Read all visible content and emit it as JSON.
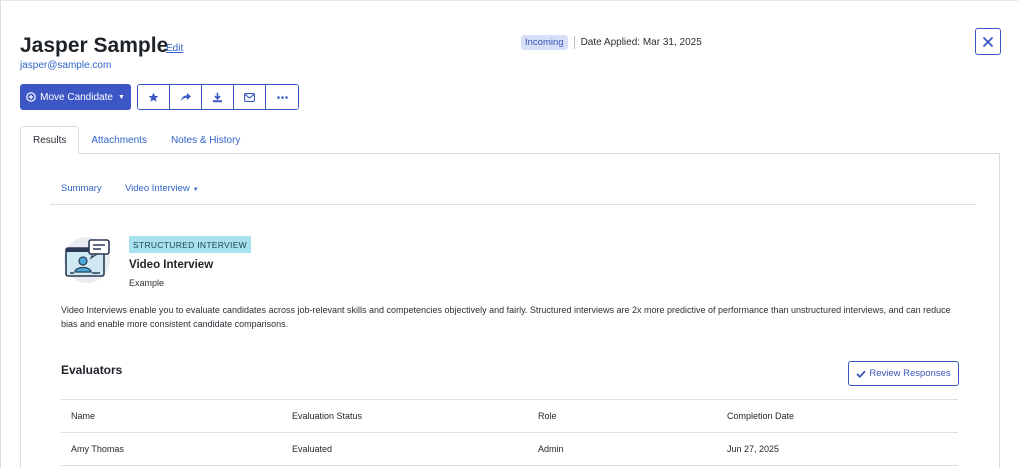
{
  "candidate": {
    "name": "Jasper Sample",
    "edit_label": "Edit",
    "email": "jasper@sample.com",
    "status": "Incoming",
    "date_applied": "Date Applied: Mar 31, 2025"
  },
  "toolbar": {
    "move_label": "Move Candidate",
    "icons": [
      "star-icon",
      "share-icon",
      "download-icon",
      "mail-icon",
      "more-icon"
    ]
  },
  "tabs": [
    {
      "label": "Results"
    },
    {
      "label": "Attachments"
    },
    {
      "label": "Notes & History"
    }
  ],
  "subtabs": [
    {
      "label": "Summary"
    },
    {
      "label": "Video Interview"
    }
  ],
  "interview": {
    "tag": "STRUCTURED INTERVIEW",
    "title": "Video Interview",
    "subtitle": "Example",
    "description": "Video Interviews enable you to evaluate candidates across job-relevant skills and competencies objectively and fairly. Structured interviews are 2x more predictive of performance than unstructured interviews, and can reduce bias and enable more consistent candidate comparisons."
  },
  "evaluators": {
    "heading": "Evaluators",
    "review_label": "Review Responses",
    "columns": [
      "Name",
      "Evaluation Status",
      "Role",
      "Completion Date"
    ],
    "rows": [
      [
        "Amy Thomas",
        "Evaluated",
        "Admin",
        "Jun 27, 2025"
      ]
    ]
  },
  "colors": {
    "accent": "#3c56c5",
    "link": "#2f63c8",
    "badge_bg": "#d7def7",
    "tag_bg": "#a9e2ef"
  }
}
